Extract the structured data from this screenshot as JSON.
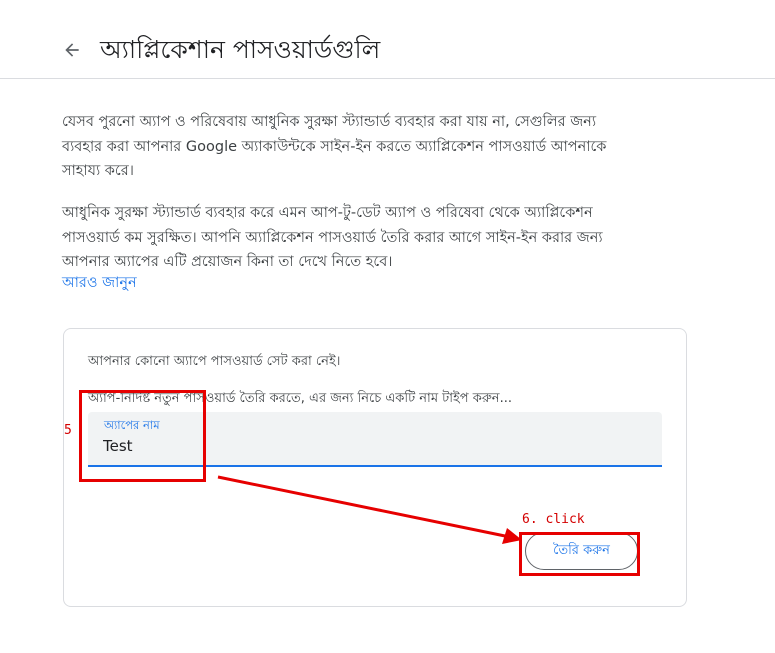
{
  "header": {
    "title": "অ্যাপ্লিকেশান পাসওয়ার্ডগুলি",
    "back_icon": "arrow-left-icon"
  },
  "intro": {
    "paragraph1": "যেসব পুরনো অ্যাপ ও পরিষেবায় আধুনিক সুরক্ষা স্ট্যান্ডার্ড ব্যবহার করা যায় না, সেগুলির জন্য ব্যবহার করা আপনার Google অ্যাকাউন্টকে সাইন-ইন করতে অ্যাপ্লিকেশন পাসওয়ার্ড আপনাকে সাহায্য করে।",
    "paragraph2": "আধুনিক সুরক্ষা স্ট্যান্ডার্ড ব্যবহার করে এমন আপ-টু-ডেট অ্যাপ ও পরিষেবা থেকে অ্যাপ্লিকেশন পাসওয়ার্ড কম সুরক্ষিত। আপনি অ্যাপ্লিকেশন পাসওয়ার্ড তৈরি করার আগে সাইন-ইন করার জন্য আপনার অ্যাপের এটি প্রয়োজন কিনা তা দেখে নিতে হবে।",
    "learn_more": "আরও জানুন"
  },
  "card": {
    "no_passwords": "আপনার কোনো অ্যাপে পাসওয়ার্ড সেট করা নেই।",
    "instruction": "অ্যাপ-নির্দিষ্ট নতুন পাসওয়ার্ড তৈরি করতে, এর জন্য নিচে একটি নাম টাইপ করুন...",
    "app_name_label": "অ্যাপের নাম",
    "app_name_value": "Test",
    "create_button": "তৈরি করুন"
  },
  "annotations": {
    "step5": "5",
    "step6": "6. click",
    "color": "#e60000"
  },
  "colors": {
    "accent": "#1a73e8",
    "text": "#202124",
    "muted": "#3c4043",
    "border": "#dadce0"
  }
}
